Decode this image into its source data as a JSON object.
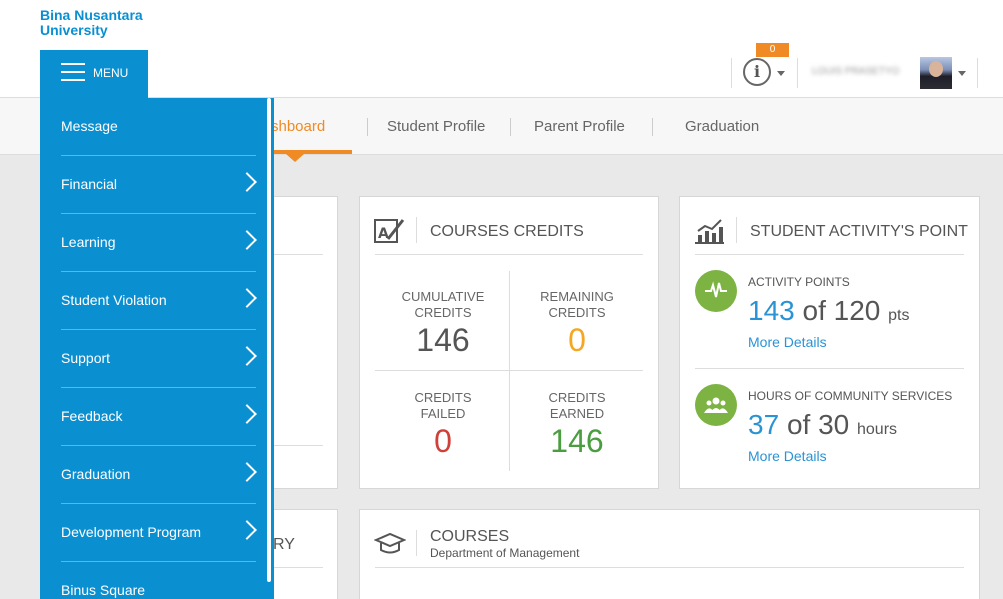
{
  "brand": {
    "line1": "Bina Nusantara",
    "line2": "University"
  },
  "menu_button": {
    "label": "MENU"
  },
  "header": {
    "notification_count": "0",
    "user_name": "LOUIS PRASETYO"
  },
  "tabs": [
    {
      "label": "shboard",
      "active": true
    },
    {
      "label": "Student Profile"
    },
    {
      "label": "Parent Profile"
    },
    {
      "label": "Graduation"
    }
  ],
  "side_menu": {
    "items": [
      {
        "label": "Message",
        "has_children": false
      },
      {
        "label": "Financial",
        "has_children": true
      },
      {
        "label": "Learning",
        "has_children": true
      },
      {
        "label": "Student Violation",
        "has_children": true
      },
      {
        "label": "Support",
        "has_children": true
      },
      {
        "label": "Feedback",
        "has_children": true
      },
      {
        "label": "Graduation",
        "has_children": true
      },
      {
        "label": "Development Program",
        "has_children": true
      },
      {
        "label": "Binus Square",
        "has_children": false
      }
    ]
  },
  "partial_card": {
    "fragment": "RY"
  },
  "courses_credits": {
    "title": "COURSES CREDITS",
    "cumulative": {
      "label1": "CUMULATIVE",
      "label2": "CREDITS",
      "value": "146"
    },
    "remaining": {
      "label1": "REMAINING",
      "label2": "CREDITS",
      "value": "0"
    },
    "failed": {
      "label1": "CREDITS",
      "label2": "FAILED",
      "value": "0"
    },
    "earned": {
      "label1": "CREDITS",
      "label2": "EARNED",
      "value": "146"
    },
    "colors": {
      "cumulative": "#555555",
      "remaining": "#f5a623",
      "failed": "#d0403a",
      "earned": "#4a9e3f"
    }
  },
  "activity": {
    "title": "STUDENT ACTIVITY'S POINT",
    "points": {
      "label": "ACTIVITY POINTS",
      "value": "143",
      "of": "of 120",
      "unit": "pts",
      "link": "More Details"
    },
    "community": {
      "label": "HOURS OF COMMUNITY SERVICES",
      "value": "37",
      "of": "of 30",
      "unit": "hours",
      "link": "More Details"
    }
  },
  "courses": {
    "title": "COURSES",
    "subtitle": "Department of Management"
  },
  "icons": [
    "hamburger-icon",
    "info-icon",
    "pencil-grid-icon",
    "bar-chart-icon",
    "heartbeat-icon",
    "people-icon",
    "graduation-cap-icon",
    "chevron-right-icon"
  ]
}
